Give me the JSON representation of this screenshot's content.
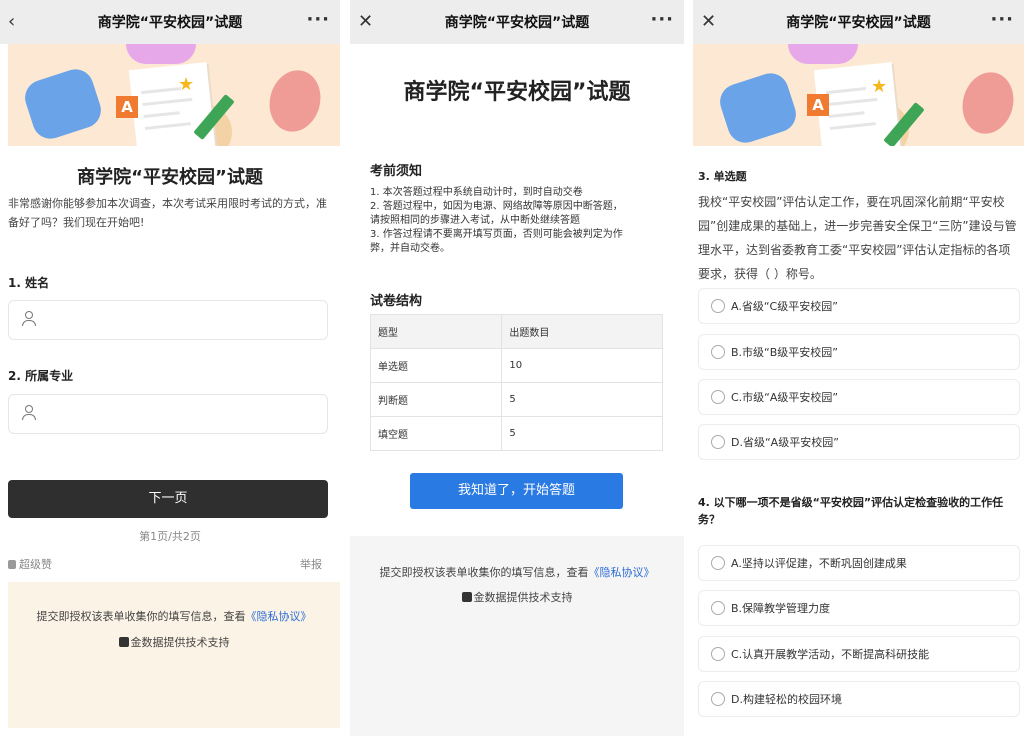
{
  "window_title": "商学院“平安校园”试题",
  "panel1": {
    "close_icon": "‹",
    "more_icon": "···",
    "form_title": "商学院“平安校园”试题",
    "intro": "非常感谢你能够参加本次调查，本次考试采用限时考试的方式，准备好了吗？我们现在开始吧!",
    "q1_label": "1. 姓名",
    "q2_label": "2. 所属专业",
    "next_button": "下一页",
    "pager": "第1页/共2页",
    "like": "超级赞",
    "report": "举报",
    "consent_prefix": "提交即授权该表单收集你的填写信息，查看",
    "privacy_link": "《隐私协议》",
    "support": "金数据提供技术支持"
  },
  "panel2": {
    "close_icon": "✕",
    "more_icon": "···",
    "heading": "商学院“平安校园”试题",
    "notice_title": "考前须知",
    "notice_lines": [
      "1. 本次答题过程中系统自动计时，到时自动交卷",
      "2. 答题过程中，如因为电源、网络故障等原因中断答题，",
      "请按照相同的步骤进入考试，从中断处继续答题",
      "3. 作答过程请不要离开填写页面，否则可能会被判定为作",
      "弊，并自动交卷。"
    ],
    "structure_title": "试卷结构",
    "table_header": [
      "题型",
      "出题数目"
    ],
    "table_rows": [
      [
        "单选题",
        "10"
      ],
      [
        "判断题",
        "5"
      ],
      [
        "填空题",
        "5"
      ]
    ],
    "start_button": "我知道了，开始答题",
    "consent_prefix": "提交即授权该表单收集你的填写信息，查看",
    "privacy_link": "《隐私协议》",
    "support": "金数据提供技术支持"
  },
  "panel3": {
    "close_icon": "✕",
    "more_icon": "···",
    "q3_label": "3. 单选题",
    "q3_text": "我校“平安校园”评估认定工作，要在巩固深化前期“平安校园”创建成果的基础上，进一步完善安全保卫“三防”建设与管理水平，达到省委教育工委“平安校园”评估认定指标的各项要求，获得（ ）称号。",
    "q3_options": [
      "A.省级“C级平安校园”",
      "B.市级“B级平安校园”",
      "C.市级“A级平安校园”",
      "D.省级“A级平安校园”"
    ],
    "q4_label": "4. 以下哪一项不是省级“平安校园”评估认定检查验收的工作任务？",
    "q4_options": [
      "A.坚持以评促建，不断巩固创建成果",
      "B.保障教学管理力度",
      "C.认真开展教学活动，不断提高科研技能",
      "D.构建轻松的校园环境"
    ]
  },
  "colors": {
    "topbar": "#ededed",
    "banner": "#fde9d3",
    "accent_blue": "#2a7ae4",
    "dark_button": "#2f2f2f",
    "link": "#2b6cd4"
  },
  "icons": [
    "close-icon",
    "more-icon",
    "person-icon",
    "thumb-up-icon",
    "radio-icon",
    "jinshuju-logo-icon"
  ]
}
